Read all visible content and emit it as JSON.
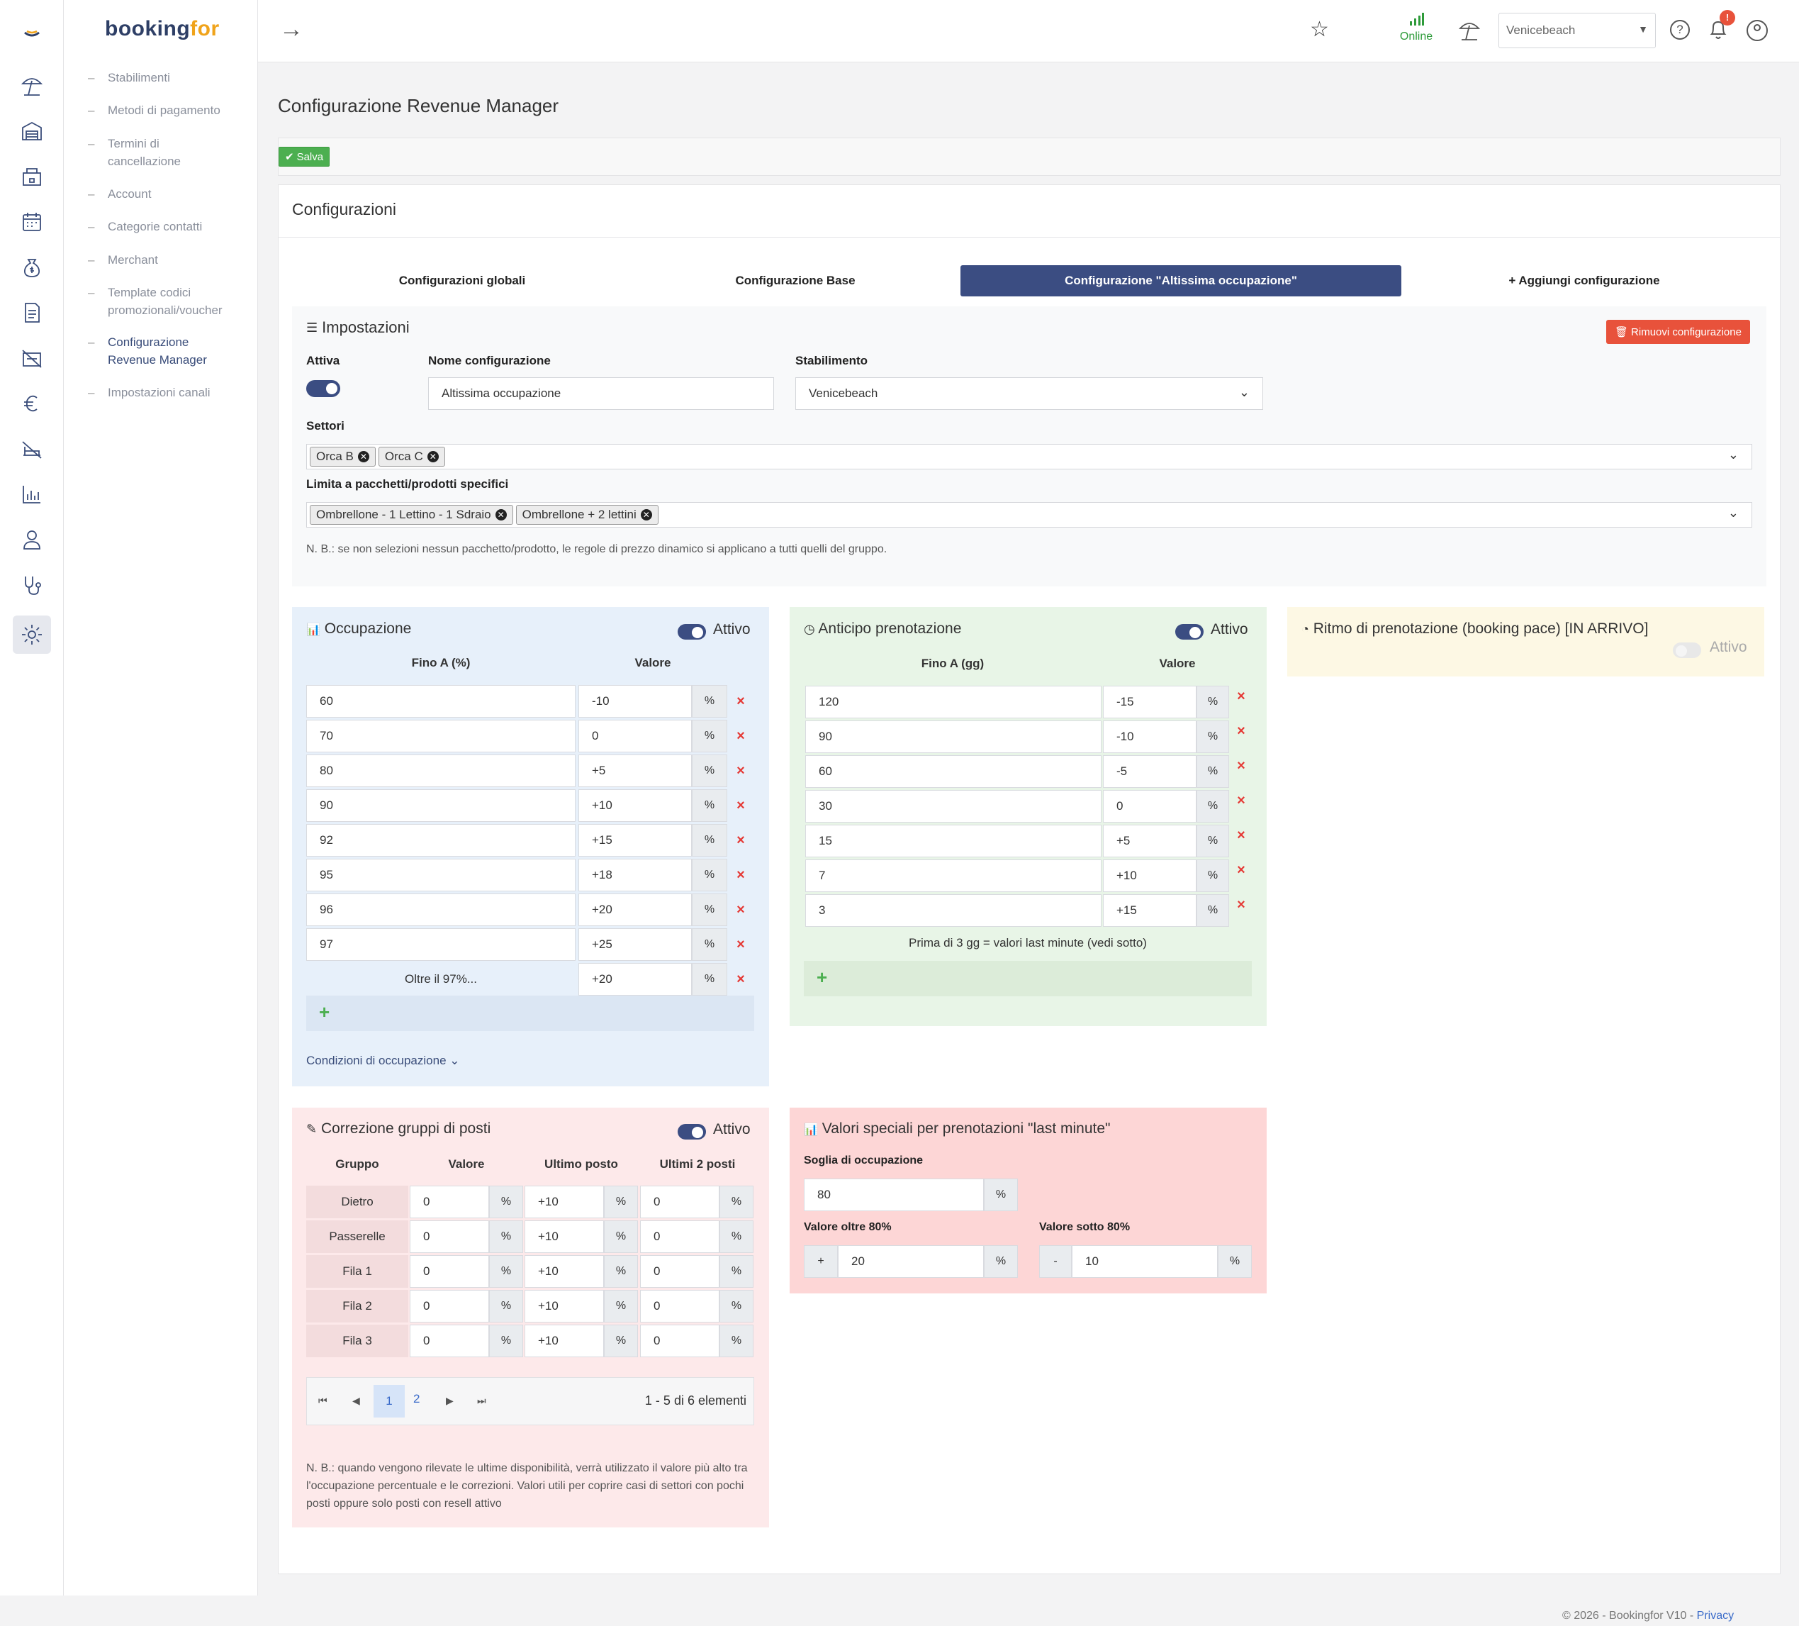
{
  "sidebar": {
    "logo_a": "booking",
    "logo_b": "for",
    "items": [
      "Stabilimenti",
      "Metodi di pagamento",
      "Termini di cancellazione",
      "Account",
      "Categorie contatti",
      "Merchant",
      "Template codici promozionali/voucher",
      "Configurazione Revenue Manager",
      "Impostazioni canali"
    ]
  },
  "topbar": {
    "status": "Online",
    "location": "Venicebeach",
    "notif_count": "!"
  },
  "page": {
    "title": "Configurazione Revenue Manager",
    "save_label": "Salva",
    "card_title": "Configurazioni",
    "tabs": [
      "Configurazioni globali",
      "Configurazione Base",
      "Configurazione \"Altissima occupazione\"",
      "Aggiungi configurazione"
    ]
  },
  "settings": {
    "title": "Impostazioni",
    "remove_label": "Rimuovi configurazione",
    "active_label": "Attiva",
    "name_label": "Nome configurazione",
    "name_value": "Altissima occupazione",
    "facility_label": "Stabilimento",
    "facility_value": "Venicebeach",
    "sectors_label": "Settori",
    "sectors": [
      "Orca B",
      "Orca C"
    ],
    "packages_label": "Limita a pacchetti/prodotti specifici",
    "packages": [
      "Ombrellone - 1 Lettino - 1 Sdraio",
      "Ombrellone + 2 lettini"
    ],
    "note": "N. B.: se non selezioni nessun pacchetto/prodotto, le regole di prezzo dinamico si applicano a tutti quelli del gruppo."
  },
  "occupancy": {
    "title": "Occupazione",
    "active": "Attivo",
    "col_a": "Fino A (%)",
    "col_b": "Valore",
    "unit": "%",
    "rows": [
      [
        "60",
        "-10"
      ],
      [
        "70",
        "0"
      ],
      [
        "80",
        "+5"
      ],
      [
        "90",
        "+10"
      ],
      [
        "92",
        "+15"
      ],
      [
        "95",
        "+18"
      ],
      [
        "96",
        "+20"
      ],
      [
        "97",
        "+25"
      ]
    ],
    "beyond_label": "Oltre il 97%...",
    "beyond_value": "+20",
    "conditions": "Condizioni di occupazione"
  },
  "advance": {
    "title": "Anticipo prenotazione",
    "active": "Attivo",
    "col_a": "Fino A (gg)",
    "col_b": "Valore",
    "unit": "%",
    "rows": [
      [
        "120",
        "-15"
      ],
      [
        "90",
        "-10"
      ],
      [
        "60",
        "-5"
      ],
      [
        "30",
        "0"
      ],
      [
        "15",
        "+5"
      ],
      [
        "7",
        "+10"
      ],
      [
        "3",
        "+15"
      ]
    ],
    "note": "Prima di 3 gg = valori last minute (vedi sotto)"
  },
  "pace": {
    "title": "Ritmo di prenotazione (booking pace) [IN ARRIVO]",
    "active": "Attivo"
  },
  "groups": {
    "title": "Correzione gruppi di posti",
    "active": "Attivo",
    "headers": [
      "Gruppo",
      "Valore",
      "Ultimo posto",
      "Ultimi 2 posti"
    ],
    "unit": "%",
    "rows": [
      [
        "Dietro",
        "0",
        "+10",
        "0"
      ],
      [
        "Passerelle",
        "0",
        "+10",
        "0"
      ],
      [
        "Fila 1",
        "0",
        "+10",
        "0"
      ],
      [
        "Fila 2",
        "0",
        "+10",
        "0"
      ],
      [
        "Fila 3",
        "0",
        "+10",
        "0"
      ]
    ],
    "pages": [
      "1",
      "2"
    ],
    "pager_info": "1 - 5 di 6 elementi",
    "note": "N. B.: quando vengono rilevate le ultime disponibilità, verrà utilizzato il valore più alto tra l'occupazione percentuale e le correzioni. Valori utili per coprire casi di settori con pochi posti oppure solo posti con resell attivo"
  },
  "lastminute": {
    "title": "Valori speciali per prenotazioni \"last minute\"",
    "threshold_label": "Soglia di occupazione",
    "threshold_value": "80",
    "unit": "%",
    "over_label": "Valore oltre 80%",
    "over_sign": "+",
    "over_value": "20",
    "under_label": "Valore sotto 80%",
    "under_sign": "-",
    "under_value": "10"
  },
  "footer": {
    "text": "© 2026 - Bookingfor V10 - ",
    "link": "Privacy"
  }
}
